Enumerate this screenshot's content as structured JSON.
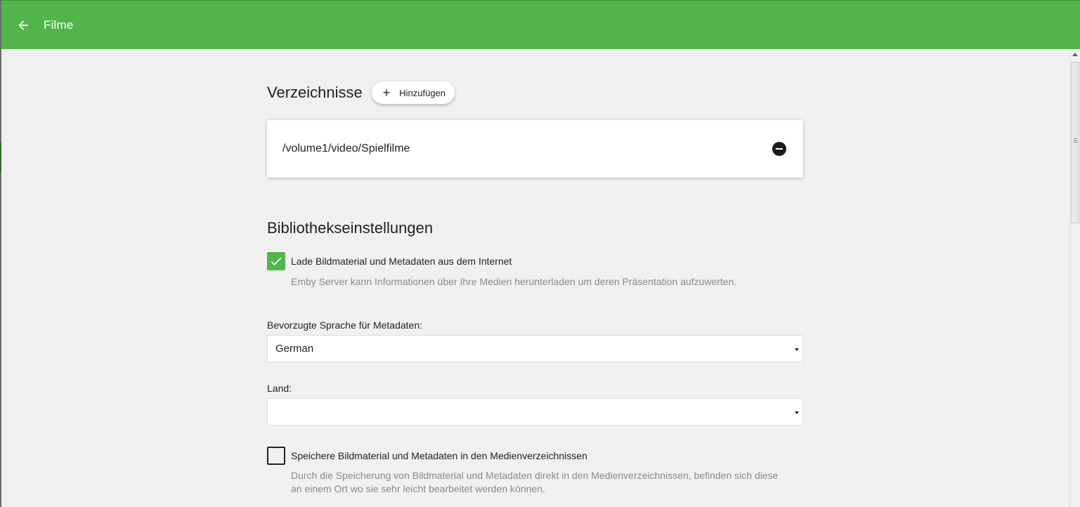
{
  "header": {
    "title": "Filme",
    "back_icon": "arrow-left-icon",
    "background": "#52b54b"
  },
  "directories": {
    "title": "Verzeichnisse",
    "add_button_label": "Hinzufügen",
    "items": [
      {
        "path": "/volume1/video/Spielfilme"
      }
    ]
  },
  "library_settings": {
    "title": "Bibliothekseinstellungen",
    "download_metadata": {
      "checked": true,
      "label": "Lade Bildmaterial und Metadaten aus dem Internet",
      "description": "Emby Server kann Informationen über Ihre Medien herunterladen um deren Präsentation aufzuwerten."
    },
    "metadata_language": {
      "label": "Bevorzugte Sprache für Metadaten:",
      "value": "German"
    },
    "country": {
      "label": "Land:",
      "value": ""
    },
    "save_local": {
      "checked": false,
      "label": "Speichere Bildmaterial und Metadaten in den Medienverzeichnissen",
      "description": "Durch die Speicherung von Bildmaterial und Metadaten direkt in den Medienverzeichnissen, befinden sich diese an einem Ort wo sie sehr leicht bearbeitet werden können."
    }
  },
  "colors": {
    "accent": "#52b54b",
    "background": "#f0f0f0",
    "helper_text": "#8a8a8a"
  }
}
